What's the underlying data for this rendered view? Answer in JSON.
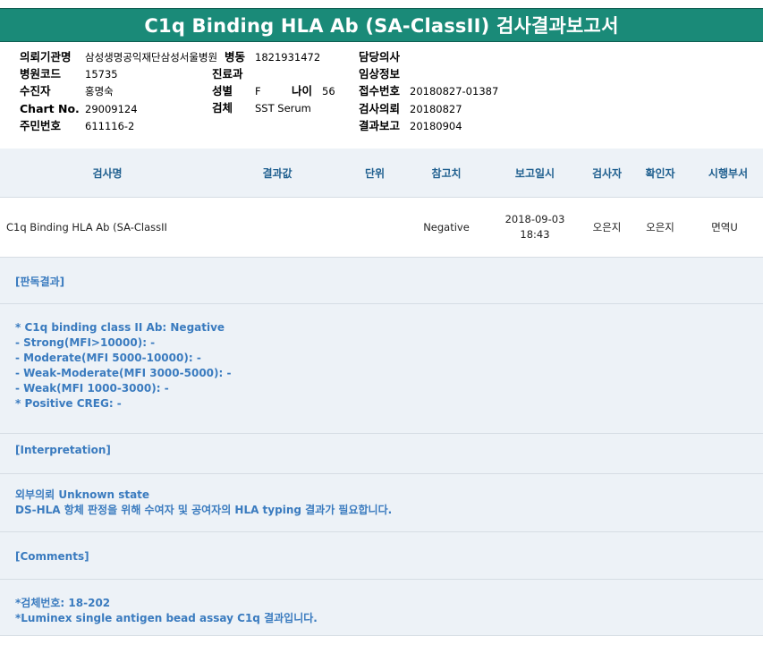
{
  "report": {
    "title": "C1q Binding HLA Ab (SA-ClassII) 검사결과보고서"
  },
  "info": {
    "hospital_label": "의뢰기관명",
    "hospital_value": "삼성생명공익재단삼성서울병원",
    "ward_label": "병동",
    "ward_value": "1821931472",
    "doctor_label": "담당의사",
    "doctor_value": "",
    "code_label": "병원코드",
    "code_value": "15735",
    "dept_label": "진료과",
    "dept_value": "",
    "clinical_label": "임상정보",
    "clinical_value": "",
    "recipient_label": "수진자",
    "recipient_value": "홍명숙",
    "sex_label": "성별",
    "sex_value": "F",
    "age_label": "나이",
    "age_value": "56",
    "receipt_label": "접수번호",
    "receipt_value": "20180827-01387",
    "chart_label": "Chart No.",
    "chart_value": "29009124",
    "specimen_label": "검체",
    "specimen_value": "SST Serum",
    "request_label": "검사의뢰",
    "request_value": "20180827",
    "id_label": "주민번호",
    "id_value": "611116-2",
    "report_label": "결과보고",
    "report_value": "20180904"
  },
  "table": {
    "headers": [
      "검사명",
      "결과값",
      "단위",
      "참고치",
      "보고일시",
      "검사자",
      "확인자",
      "시행부서"
    ],
    "row": {
      "test_name": "C1q Binding HLA Ab (SA-ClassII",
      "result": "",
      "unit": "",
      "reference": "Negative",
      "report_date": "2018-09-03",
      "report_time": "18:43",
      "tester": "오은지",
      "confirmer": "오은지",
      "dept": "면역U"
    }
  },
  "sections": {
    "judgment_heading": "[판독결과]",
    "judgment_lines": [
      "* C1q binding class II Ab: Negative",
      "- Strong(MFI>10000): -",
      "- Moderate(MFI 5000-10000): -",
      "- Weak-Moderate(MFI 3000-5000): -",
      "- Weak(MFI 1000-3000): -",
      "* Positive CREG: -"
    ],
    "interpretation_heading": "[Interpretation]",
    "interpretation_lines": [
      "외부의뢰 Unknown state",
      "DS-HLA 항체 판정을 위해 수여자 및 공여자의 HLA typing 결과가 필요합니다."
    ],
    "comments_heading": "[Comments]",
    "comments_lines": [
      "*검체번호: 18-202",
      "*Luminex single antigen bead assay C1q 결과입니다."
    ]
  },
  "colors": {
    "title_bg": "#1a8a78",
    "section_bg": "#edf2f7",
    "header_text": "#1f5f8f",
    "section_text": "#3a7bbf"
  }
}
